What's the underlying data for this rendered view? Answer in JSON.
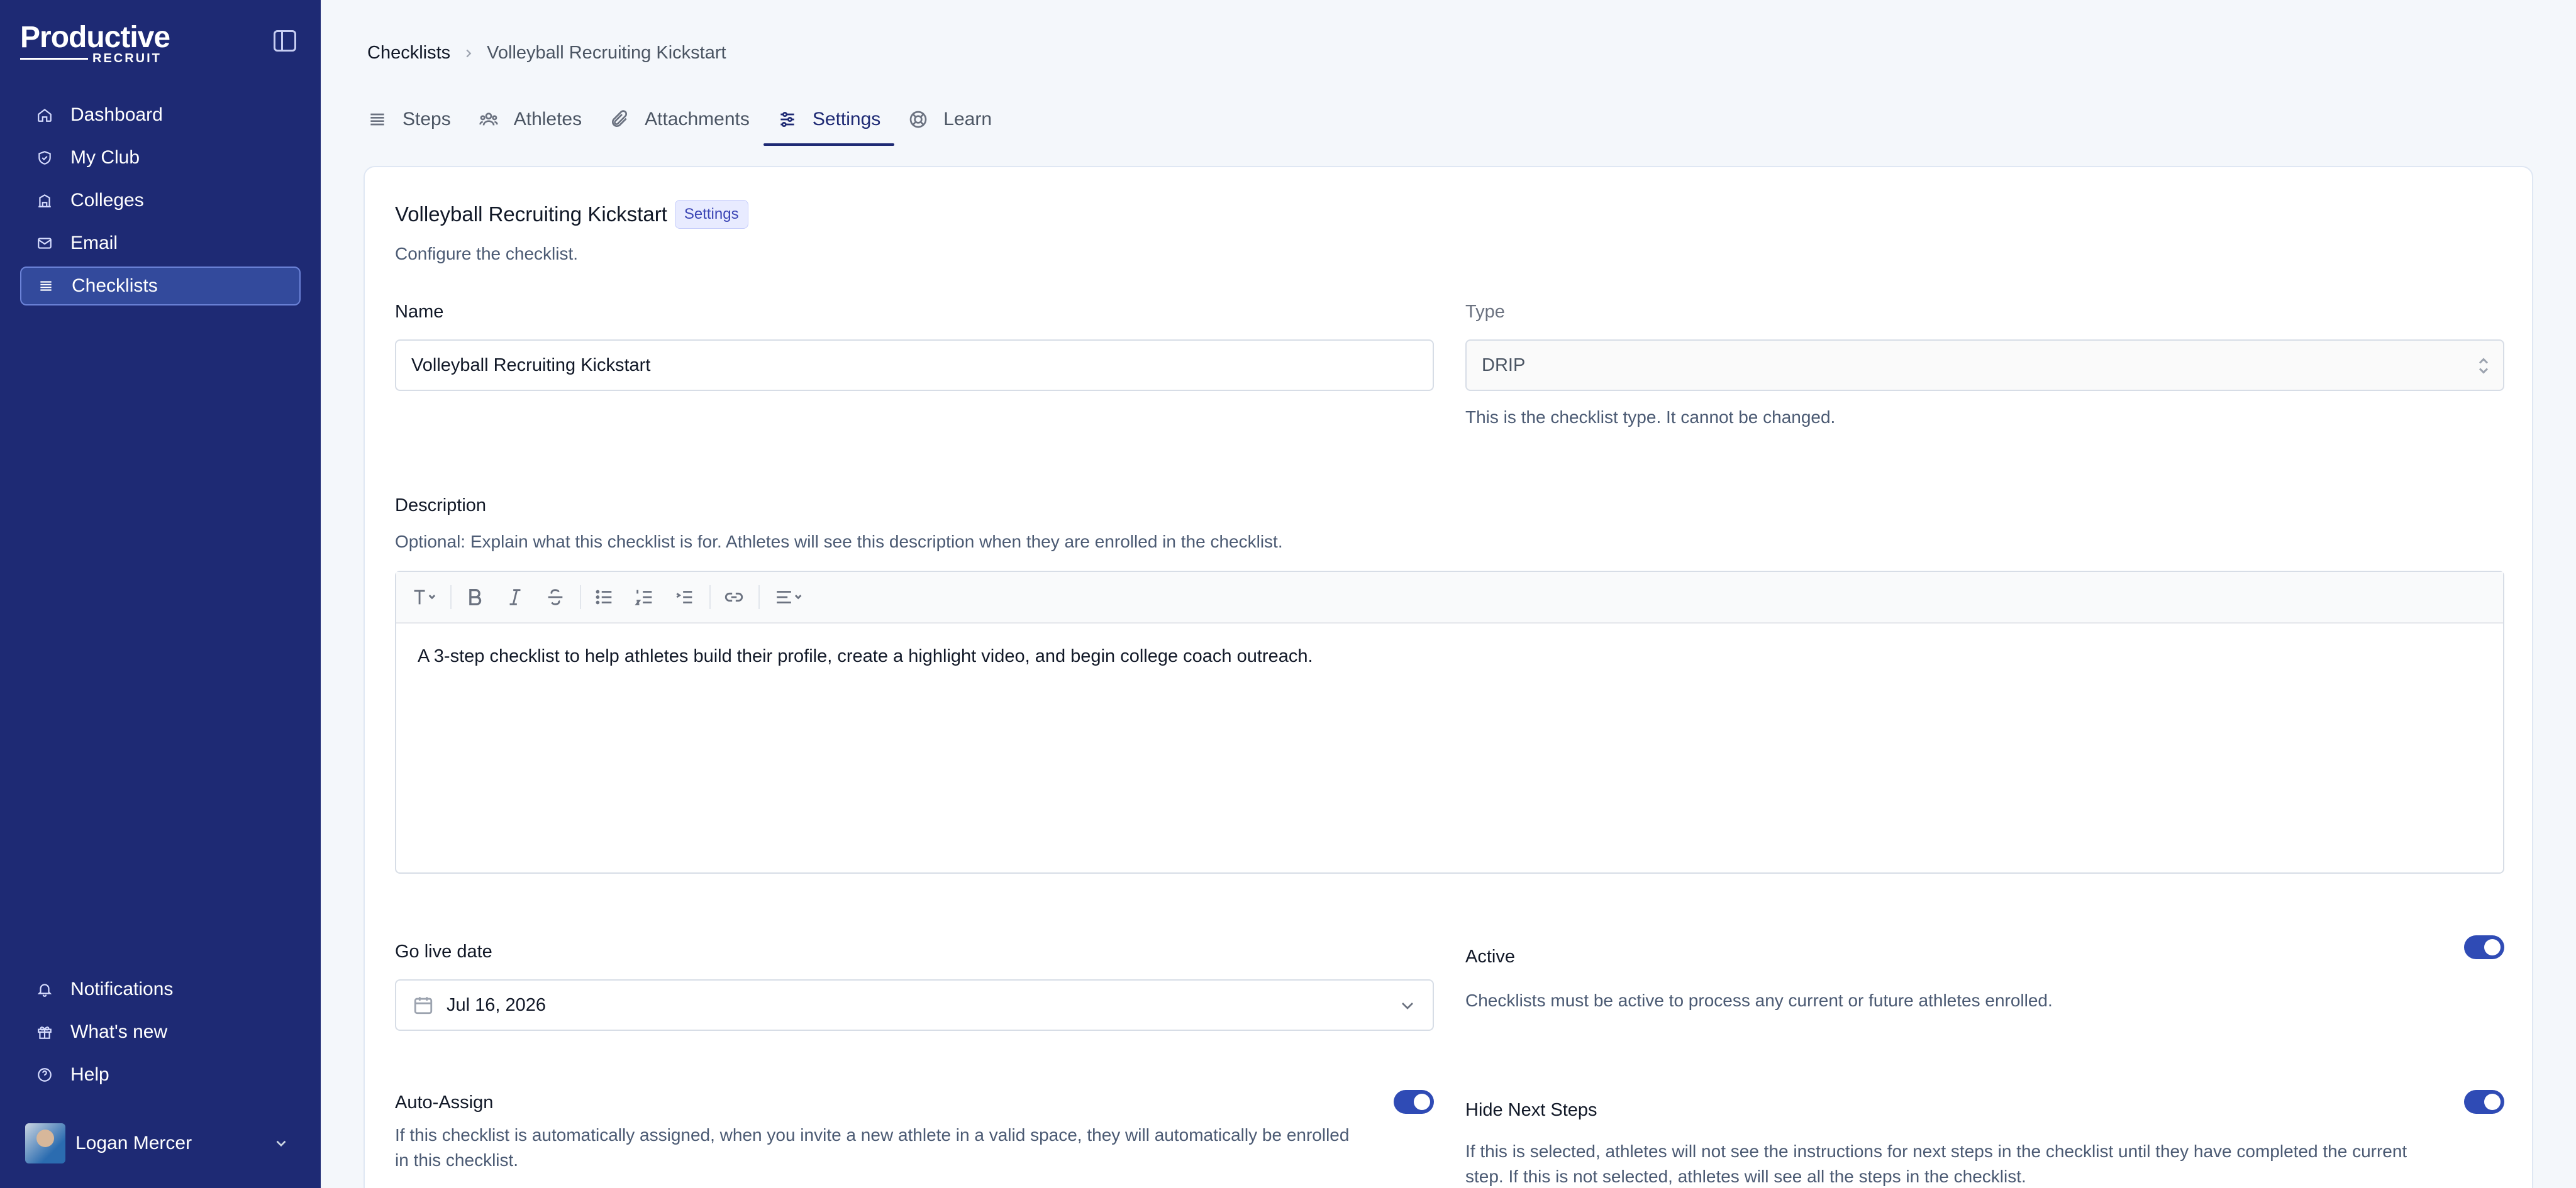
{
  "app": {
    "logo_word": "Productive",
    "logo_sub": "RECRUIT"
  },
  "sidebar": {
    "items": [
      {
        "label": "Dashboard",
        "icon": "home-icon"
      },
      {
        "label": "My Club",
        "icon": "shield-icon"
      },
      {
        "label": "Colleges",
        "icon": "building-icon"
      },
      {
        "label": "Email",
        "icon": "mail-icon"
      },
      {
        "label": "Checklists",
        "icon": "list-icon",
        "active": true
      }
    ],
    "bottom_items": [
      {
        "label": "Notifications",
        "icon": "bell-icon"
      },
      {
        "label": "What's new",
        "icon": "gift-icon"
      },
      {
        "label": "Help",
        "icon": "help-circle-icon"
      }
    ],
    "user": {
      "name": "Logan Mercer"
    }
  },
  "breadcrumb": {
    "root": "Checklists",
    "current": "Volleyball Recruiting Kickstart"
  },
  "tabs": [
    {
      "label": "Steps",
      "icon": "list-icon"
    },
    {
      "label": "Athletes",
      "icon": "users-icon"
    },
    {
      "label": "Attachments",
      "icon": "paperclip-icon"
    },
    {
      "label": "Settings",
      "icon": "sliders-icon",
      "active": true
    },
    {
      "label": "Learn",
      "icon": "lifebuoy-icon"
    }
  ],
  "settings": {
    "title": "Volleyball Recruiting Kickstart",
    "badge": "Settings",
    "subtitle": "Configure the checklist.",
    "name_label": "Name",
    "name_value": "Volleyball Recruiting Kickstart",
    "type_label": "Type",
    "type_value": "DRIP",
    "type_help": "This is the checklist type. It cannot be changed.",
    "description_label": "Description",
    "description_help": "Optional: Explain what this checklist is for. Athletes will see this description when they are enrolled in the checklist.",
    "description_text": "A 3-step checklist to help athletes build their profile, create a highlight video, and begin college coach outreach.",
    "go_live_label": "Go live date",
    "go_live_value": "Jul 16, 2026",
    "active_label": "Active",
    "active_help": "Checklists must be active to process any current or future athletes enrolled.",
    "active_on": true,
    "auto_assign_label": "Auto-Assign",
    "auto_assign_help": "If this checklist is automatically assigned, when you invite a new athlete in a valid space, they will automatically be enrolled in this checklist.",
    "auto_assign_on": true,
    "hide_next_label": "Hide Next Steps",
    "hide_next_help": "If this is selected, athletes will not see the instructions for next steps in the checklist until they have completed the current step. If this is not selected, athletes will see all the steps in the checklist.",
    "hide_next_on": true
  },
  "colors": {
    "sidebar_bg": "#1e2a74",
    "accent": "#2f4bb5",
    "badge_bg": "#e8ebff"
  }
}
